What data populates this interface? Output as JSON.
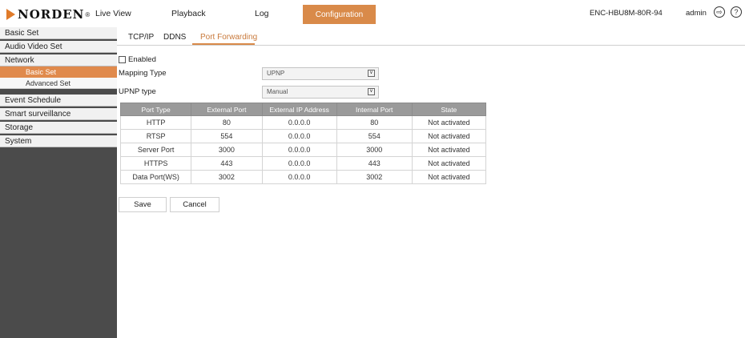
{
  "header": {
    "logo_text": "NORDEN",
    "logo_mark": "®",
    "nav": [
      "Live View",
      "Playback",
      "Log",
      "Configuration"
    ],
    "active_nav": "Configuration",
    "device_name": "ENC-HBU8M-80R-94",
    "user": "admin",
    "logout_icon": "logout-icon",
    "help_icon": "help-icon",
    "accent_color": "#d98a49"
  },
  "sidebar": {
    "items": [
      "Basic Set",
      "Audio Video Set",
      "Network",
      "Basic Set",
      "Advanced Set",
      "Event Schedule",
      "Smart surveillance",
      "Storage",
      "System"
    ]
  },
  "tabs": [
    "TCP/IP",
    "DDNS",
    "Port Forwarding"
  ],
  "active_tab": "Port Forwarding",
  "form": {
    "enabled_label": "Enabled",
    "enabled_checked": false,
    "mapping_type_label": "Mapping Type",
    "mapping_type_value": "UPNP",
    "upnp_type_label": "UPNP type",
    "upnp_type_value": "Manual"
  },
  "table": {
    "headers": [
      "Port Type",
      "External Port",
      "External IP Address",
      "Internal Port",
      "State"
    ],
    "rows": [
      [
        "HTTP",
        "80",
        "0.0.0.0",
        "80",
        "Not activated"
      ],
      [
        "RTSP",
        "554",
        "0.0.0.0",
        "554",
        "Not activated"
      ],
      [
        "Server Port",
        "3000",
        "0.0.0.0",
        "3000",
        "Not activated"
      ],
      [
        "HTTPS",
        "443",
        "0.0.0.0",
        "443",
        "Not activated"
      ],
      [
        "Data Port(WS)",
        "3002",
        "0.0.0.0",
        "3002",
        "Not activated"
      ]
    ]
  },
  "buttons": {
    "save": "Save",
    "cancel": "Cancel"
  }
}
